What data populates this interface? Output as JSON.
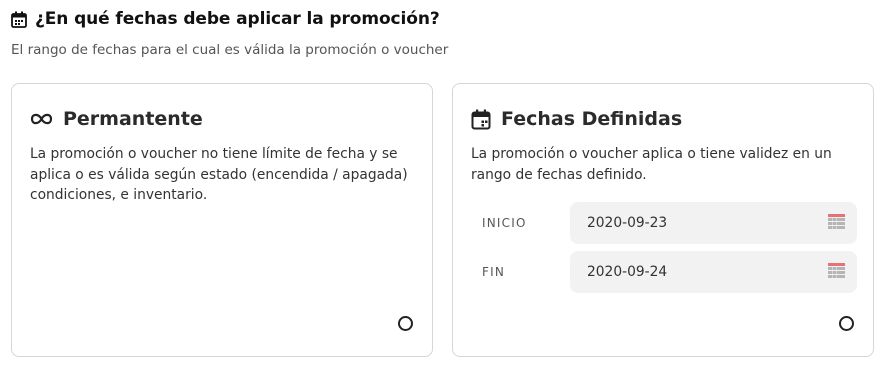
{
  "section": {
    "title": "¿En qué fechas debe aplicar la promoción?",
    "subtitle": "El rango de fechas para el cual es válida la promoción o voucher",
    "icon": "calendar-icon"
  },
  "options": [
    {
      "title": "Permantente",
      "description": "La promoción o voucher no tiene límite de fecha y se aplica o es válida según estado (encendida / apagada) condiciones, e inventario.",
      "icon": "infinity-icon",
      "selected": false
    },
    {
      "title": "Fechas Definidas",
      "description": "La promoción o voucher aplica o tiene validez en un rango de fechas definido.",
      "icon": "calendar-icon",
      "selected": false,
      "start_label": "INICIO",
      "start_value": "2020-09-23",
      "end_label": "FIN",
      "end_value": "2020-09-24",
      "date_picker_icon": "calendar-grid-icon"
    }
  ],
  "colors": {
    "border": "#d6d6d6",
    "input_bg": "#f2f2f2",
    "picker_top": "#e57373",
    "picker_grid": "#b5b5b5"
  }
}
